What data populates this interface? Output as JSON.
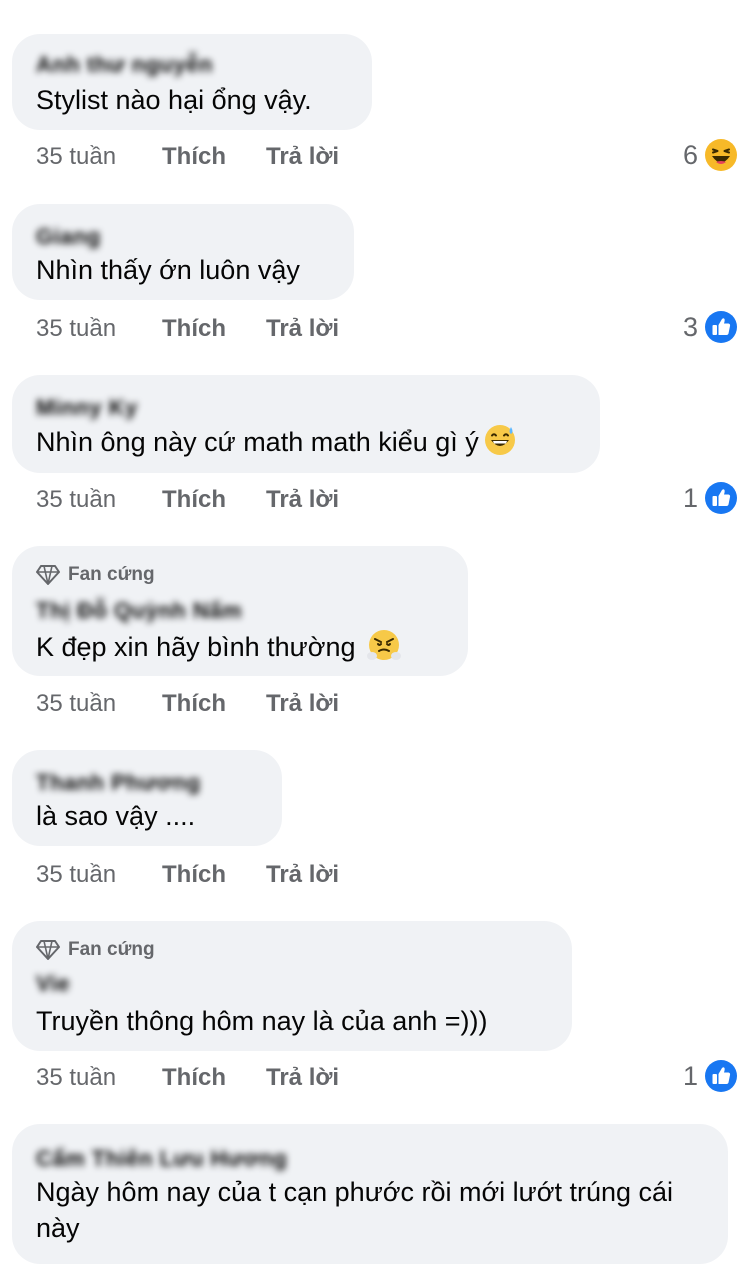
{
  "comments": [
    {
      "author": "Anh thư nguyễn",
      "text": "Stylist nào hại ổng vậy.",
      "time": "35 tuần",
      "like_label": "Thích",
      "reply_label": "Trả lời",
      "reaction_count": "6",
      "reaction_icon": "laugh-reaction-icon"
    },
    {
      "author": "Giang",
      "text": "Nhìn thấy ớn luôn vậy",
      "time": "35 tuần",
      "like_label": "Thích",
      "reply_label": "Trả lời",
      "reaction_count": "3",
      "reaction_icon": "like-reaction-icon"
    },
    {
      "author": "Minny Ky",
      "text": "Nhìn ông này cứ math math kiểu gì ý",
      "text_emoji": "grinning-sweat-emoji",
      "time": "35 tuần",
      "like_label": "Thích",
      "reply_label": "Trả lời",
      "reaction_count": "1",
      "reaction_icon": "like-reaction-icon"
    },
    {
      "badge": "Fan cứng",
      "badge_icon": "diamond-icon",
      "author": "Thị Đỗ Quỳnh Nấm",
      "text": "K đẹp xin hãy bình thường",
      "text_emoji": "triumph-face-emoji",
      "time": "35 tuần",
      "like_label": "Thích",
      "reply_label": "Trả lời"
    },
    {
      "author": "Thanh Phương",
      "text": "là sao vậy ....",
      "time": "35 tuần",
      "like_label": "Thích",
      "reply_label": "Trả lời"
    },
    {
      "badge": "Fan cứng",
      "badge_icon": "diamond-icon",
      "author": "Vie",
      "text": "Truyền thông hôm nay là của anh =)))",
      "time": "35 tuần",
      "like_label": "Thích",
      "reply_label": "Trả lời",
      "reaction_count": "1",
      "reaction_icon": "like-reaction-icon"
    },
    {
      "author": "Cẩm Thiên Lưu Hương",
      "text": "Ngày hôm nay của t cạn phước rồi mới lướt trúng cái này"
    }
  ],
  "colors": {
    "bubble_bg": "#f0f2f5",
    "meta_text": "#65676b",
    "like_blue": "#1877f2",
    "haha_yellow": "#f7b928"
  }
}
